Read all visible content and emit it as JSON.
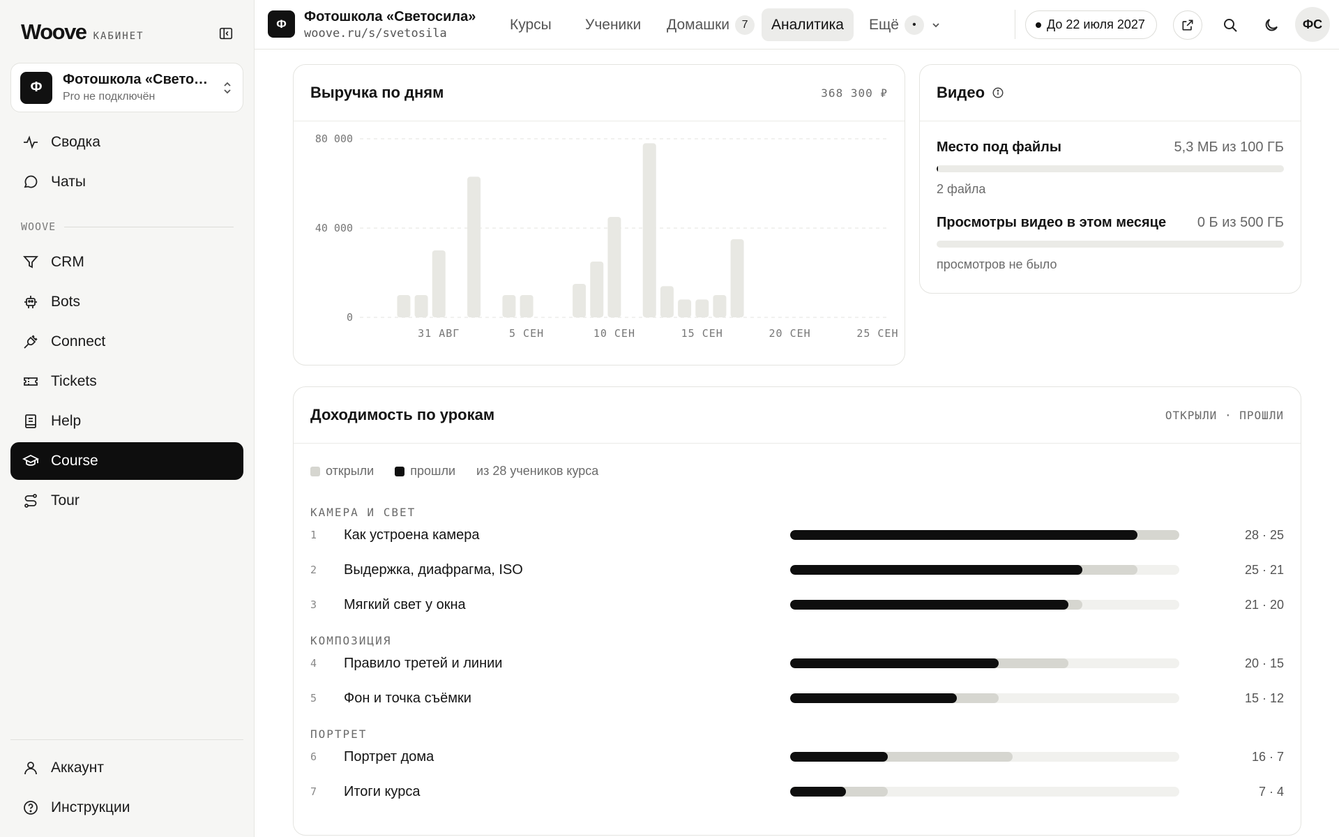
{
  "sidebar": {
    "brand": "Woove",
    "brand_sub": "КАБИНЕТ",
    "workspace": {
      "avatar": "Ф",
      "title": "Фотошкола «Светосила»",
      "subtitle": "Pro не подключён"
    },
    "items_top": [
      {
        "label": "Сводка",
        "icon": "pulse-icon"
      },
      {
        "label": "Чаты",
        "icon": "chat-icon"
      }
    ],
    "section": "WOOVE",
    "items_main": [
      {
        "label": "CRM",
        "icon": "funnel-icon"
      },
      {
        "label": "Bots",
        "icon": "robot-icon"
      },
      {
        "label": "Connect",
        "icon": "plug-icon"
      },
      {
        "label": "Tickets",
        "icon": "ticket-icon"
      },
      {
        "label": "Help",
        "icon": "book-icon"
      },
      {
        "label": "Course",
        "icon": "graduation-cap-icon",
        "active": true
      },
      {
        "label": "Tour",
        "icon": "route-icon"
      }
    ],
    "items_bottom": [
      {
        "label": "Аккаунт",
        "icon": "user-icon"
      },
      {
        "label": "Инструкции",
        "icon": "help-circle-icon"
      }
    ]
  },
  "header": {
    "site_avatar": "Ф",
    "site_title": "Фотошкола «Светосила»",
    "site_url": "woove.ru/s/svetosila",
    "tabs": [
      {
        "label": "Курсы"
      },
      {
        "label": "Ученики"
      },
      {
        "label": "Домашки",
        "badge": "7"
      },
      {
        "label": "Аналитика",
        "active": true
      },
      {
        "label": "Ещё",
        "badge": "•"
      }
    ],
    "plan_pill": "До 22 июля 2027",
    "user_initials": "ФС"
  },
  "revenue": {
    "title": "Выручка по дням",
    "total": "368 300 ₽"
  },
  "chart_data": {
    "type": "bar",
    "title": "Выручка по дням",
    "ylim": [
      0,
      80000
    ],
    "y_ticks": [
      "80 000",
      "40 000",
      "0"
    ],
    "x_tick_labels": [
      {
        "label": "31 АВГ",
        "day": 4
      },
      {
        "label": "5 СЕН",
        "day": 9
      },
      {
        "label": "10 СЕН",
        "day": 14
      },
      {
        "label": "15 СЕН",
        "day": 19
      },
      {
        "label": "20 СЕН",
        "day": 24
      },
      {
        "label": "25 СЕН",
        "day": 29
      }
    ],
    "days": 30,
    "bars": [
      {
        "day": 2,
        "value": 10000
      },
      {
        "day": 3,
        "value": 10000
      },
      {
        "day": 4,
        "value": 30000
      },
      {
        "day": 6,
        "value": 63000
      },
      {
        "day": 8,
        "value": 10000
      },
      {
        "day": 9,
        "value": 10000
      },
      {
        "day": 12,
        "value": 15000
      },
      {
        "day": 13,
        "value": 25000
      },
      {
        "day": 14,
        "value": 45000
      },
      {
        "day": 16,
        "value": 78000
      },
      {
        "day": 17,
        "value": 14000
      },
      {
        "day": 18,
        "value": 8000
      },
      {
        "day": 19,
        "value": 8000
      },
      {
        "day": 20,
        "value": 10000
      },
      {
        "day": 21,
        "value": 35000
      }
    ],
    "grid": true,
    "bar_color": "#e8e8e3"
  },
  "video": {
    "title": "Видео",
    "storage": {
      "label": "Место под файлы",
      "value": "5,3 МБ из 100 ГБ",
      "fraction": 0.003,
      "sub": "2 файла"
    },
    "views": {
      "label": "Просмотры видео в этом месяце",
      "value": "0 Б из 500 ГБ",
      "fraction": 0,
      "sub": "просмотров не было"
    }
  },
  "lessons": {
    "title": "Доходимость по урокам",
    "meta": "ОТКРЫЛИ · ПРОШЛИ",
    "legend_opened": "открыли",
    "legend_passed": "прошли",
    "legend_note": "из 28 учеников курса",
    "total_students": 28,
    "sections": [
      {
        "title": "КАМЕРА И СВЕТ",
        "items": [
          {
            "num": "1",
            "title": "Как устроена камера",
            "opened": 28,
            "passed": 25,
            "stat": "28 · 25"
          },
          {
            "num": "2",
            "title": "Выдержка, диафрагма, ISO",
            "opened": 25,
            "passed": 21,
            "stat": "25 · 21"
          },
          {
            "num": "3",
            "title": "Мягкий свет у окна",
            "opened": 21,
            "passed": 20,
            "stat": "21 · 20"
          }
        ]
      },
      {
        "title": "КОМПОЗИЦИЯ",
        "items": [
          {
            "num": "4",
            "title": "Правило третей и линии",
            "opened": 20,
            "passed": 15,
            "stat": "20 · 15"
          },
          {
            "num": "5",
            "title": "Фон и точка съёмки",
            "opened": 15,
            "passed": 12,
            "stat": "15 · 12"
          }
        ]
      },
      {
        "title": "ПОРТРЕТ",
        "items": [
          {
            "num": "6",
            "title": "Портрет дома",
            "opened": 16,
            "passed": 7,
            "stat": "16 · 7"
          },
          {
            "num": "7",
            "title": "Итоги курса",
            "opened": 7,
            "passed": 4,
            "stat": "7 · 4"
          }
        ]
      }
    ]
  }
}
